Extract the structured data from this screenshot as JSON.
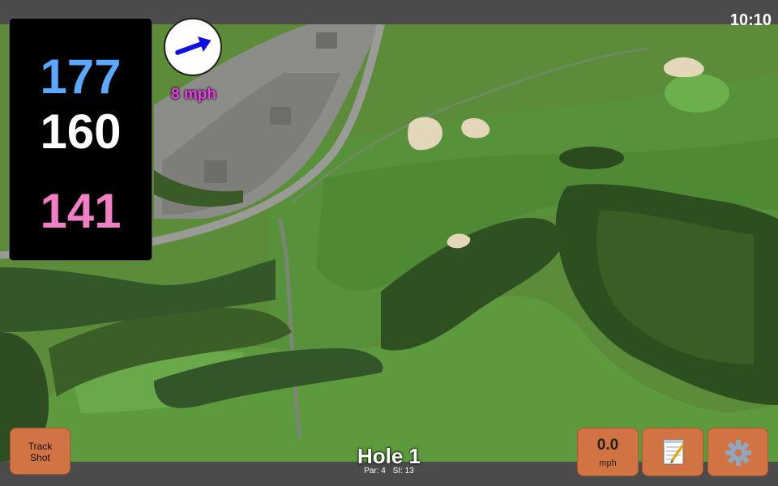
{
  "status_bar": {
    "time": "10:10"
  },
  "yardages": {
    "back": "177",
    "middle": "160",
    "front": "141"
  },
  "wind": {
    "speed_label": "8 mph",
    "direction_icon": "arrow-icon"
  },
  "hole": {
    "title": "Hole 1",
    "par_label": "Par: 4",
    "si_label": "SI: 13"
  },
  "buttons": {
    "track_line1": "Track",
    "track_line2": "Shot",
    "speed_value": "0.0",
    "speed_unit": "mph",
    "notes_icon": "notepad-icon",
    "settings_icon": "gear-icon"
  },
  "colors": {
    "back_yardage": "#5aa8ff",
    "middle_yardage": "#ffffff",
    "front_yardage": "#f27fc6",
    "wind_text": "#f23ef0",
    "button": "#d17343",
    "bar": "#4b4b4b"
  }
}
